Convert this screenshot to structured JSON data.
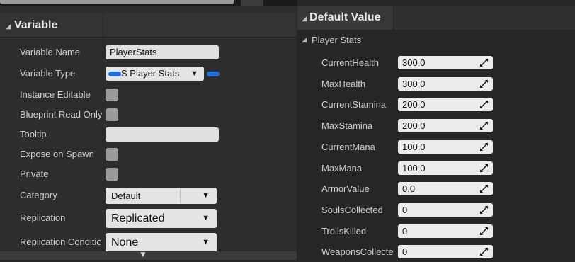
{
  "left_panel": {
    "header_title": "Variable",
    "properties": {
      "variable_name": {
        "label": "Variable Name",
        "value": "PlayerStats"
      },
      "variable_type": {
        "label": "Variable Type",
        "value": "S Player Stats"
      },
      "instance_editable": {
        "label": "Instance Editable",
        "checked": false
      },
      "blueprint_read_only": {
        "label": "Blueprint Read Only",
        "checked": false
      },
      "tooltip": {
        "label": "Tooltip",
        "value": ""
      },
      "expose_on_spawn": {
        "label": "Expose on Spawn",
        "checked": false
      },
      "private": {
        "label": "Private",
        "checked": false
      },
      "category": {
        "label": "Category",
        "value": "Default"
      },
      "replication": {
        "label": "Replication",
        "value": "Replicated"
      },
      "replication_condition": {
        "label": "Replication Conditic",
        "value": "None"
      }
    }
  },
  "right_panel": {
    "header_title": "Default Value",
    "group_label": "Player Stats",
    "stats": [
      {
        "label": "CurrentHealth",
        "value": "300,0"
      },
      {
        "label": "MaxHealth",
        "value": "300,0"
      },
      {
        "label": "CurrentStamina",
        "value": "200,0"
      },
      {
        "label": "MaxStamina",
        "value": "200,0"
      },
      {
        "label": "CurrentMana",
        "value": "100,0"
      },
      {
        "label": "MaxMana",
        "value": "100,0"
      },
      {
        "label": "ArmorValue",
        "value": "0,0"
      },
      {
        "label": "SoulsCollected",
        "value": "0"
      },
      {
        "label": "TrollsKilled",
        "value": "0"
      },
      {
        "label": "WeaponsCollecte",
        "value": "0"
      }
    ]
  },
  "colors": {
    "struct_pin": "#1f6fe0"
  }
}
